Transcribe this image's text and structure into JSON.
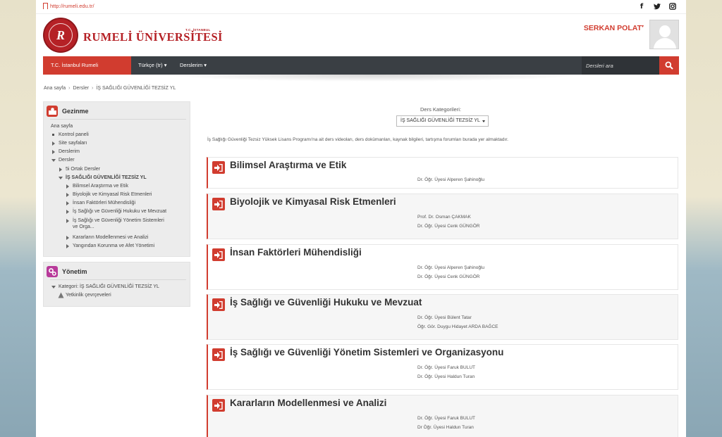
{
  "top": {
    "url": "http://rumeli.edu.tr/"
  },
  "header": {
    "logo_small": "T.C. İSTANBUL",
    "logo_text": "RUMELİ ÜNİVERSİTESİ",
    "user_name": "SERKAN POLAT"
  },
  "nav": {
    "home": "T.C. İstanbul Rumeli Üniversitesi",
    "language": "Türkçe (tr)",
    "my_courses": "Derslerim",
    "search_placeholder": "Dersleri ara"
  },
  "breadcrumb": [
    "Ana sayfa",
    "Dersler",
    "İŞ SAĞLIĞI GÜVENLİĞİ TEZSİZ YL"
  ],
  "navigation_block": {
    "title": "Gezinme",
    "items": [
      "Ana sayfa",
      "Kontrol paneli",
      "Site sayfaları",
      "Derslerim",
      "Dersler",
      "5i Ortak Dersler",
      "İŞ SAĞLIĞI GÜVENLİĞİ TEZSİZ YL",
      "Bilimsel Araştırma ve Etik",
      "Biyolojik ve Kimyasal Risk Etmenleri",
      "İnsan Faktörleri Mühendisliği",
      "İş Sağlığı ve Güvenliği Hukuku ve Mevzuat",
      "İş Sağlığı ve Güvenliği Yönetim Sistemleri ve Orga...",
      "Kararların Modellenmesi ve Analizi",
      "Yangından Korunma ve Afet Yönetimi"
    ]
  },
  "admin_block": {
    "title": "Yönetim",
    "items": [
      "Kategori: İŞ SAĞLIĞI GÜVENLİĞİ TEZSİZ YL",
      "Yetkinlik çevrçeveleri"
    ]
  },
  "main": {
    "category_label": "Ders Kategorileri:",
    "category_selected": "İŞ SAĞLIĞI GÜVENLİĞİ TEZSİZ YL",
    "intro": "İş Sağlığı Güvenliği Tezsiz Yüksek Lisans Programı'na ait ders videoları, ders dokümanları, kaynak bilgileri, tartışma forumları burada yer almaktadır.",
    "courses": [
      {
        "title": "Bilimsel Araştırma ve Etik",
        "teachers": [
          "Dr. Öğr. Üyesi Alperen Şahinoğlu"
        ]
      },
      {
        "title": "Biyolojik ve Kimyasal Risk Etmenleri",
        "teachers": [
          "Prof. Dr. Osman ÇAKMAK",
          "Dr. Öğr. Üyesi Cenk GÜNGÖR"
        ]
      },
      {
        "title": "İnsan Faktörleri Mühendisliği",
        "teachers": [
          "Dr. Öğr. Üyesi Alperen Şahinoğlu",
          "Dr. Öğr. Üyesi Cenk GÜNGÖR"
        ]
      },
      {
        "title": "İş Sağlığı ve Güvenliği Hukuku ve Mevzuat",
        "teachers": [
          "Dr. Öğr. Üyesi Bülent Tatar",
          "Öğr. Gör. Duygu Hidayet ARDA BAĞCE"
        ]
      },
      {
        "title": "İş Sağlığı ve Güvenliği Yönetim Sistemleri ve Organizasyonu",
        "teachers": [
          "Dr. Öğr. Üyesi Faruk BULUT",
          "Dr. Öğr. Üyesi Haldun Turan"
        ]
      },
      {
        "title": "Kararların Modellenmesi ve Analizi",
        "teachers": [
          "Dr. Öğr. Üyesi Faruk BULUT",
          "Dr Öğr. Üyesi Haldun Turan"
        ]
      }
    ]
  },
  "colors": {
    "accent": "#d13c2f",
    "nav_bg": "#3a3f44",
    "sidebar_bg": "#ececec",
    "admin_icon": "#b83a9a"
  }
}
